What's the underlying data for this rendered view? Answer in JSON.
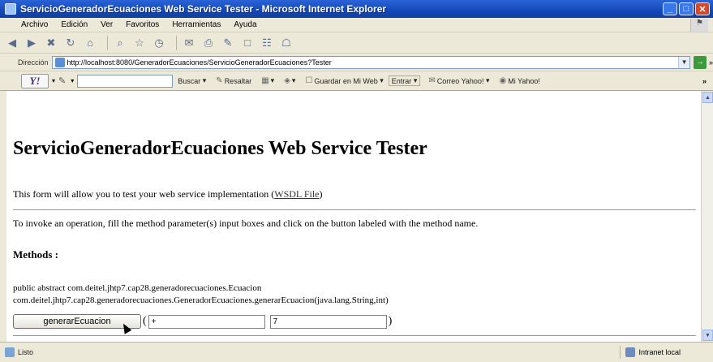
{
  "window": {
    "title": "ServicioGeneradorEcuaciones Web Service Tester - Microsoft Internet Explorer",
    "minimize": "_",
    "maximize": "□",
    "close": "✕"
  },
  "menubar": {
    "items": [
      "Archivo",
      "Edición",
      "Ver",
      "Favoritos",
      "Herramientas",
      "Ayuda"
    ]
  },
  "address": {
    "label": "Dirección",
    "url": "http://localhost:8080/GeneradorEcuaciones/ServicioGeneradorEcuaciones?Tester",
    "go_more": "»"
  },
  "yahoo": {
    "logo": "Y!",
    "search_label": "Buscar",
    "highlight_label": "Resaltar",
    "save_label": "Guardar en Mi Web",
    "enter_label": "Entrar",
    "mail_label": "Correo Yahoo!",
    "myyahoo_label": "Mi Yahoo!",
    "more": "»"
  },
  "page": {
    "title": "ServicioGeneradorEcuaciones Web Service Tester",
    "intro_text": "This form will allow you to test your web service implementation (",
    "intro_link": "WSDL File",
    "intro_close": ")",
    "invoke_text": "To invoke an operation, fill the method parameter(s) input boxes and click on the button labeled with the method name.",
    "methods_heading": "Methods :",
    "signature_line1": "public abstract com.deitel.jhtp7.cap28.generadorecuaciones.Ecuacion",
    "signature_line2": "com.deitel.jhtp7.cap28.generadorecuaciones.GeneradorEcuaciones.generarEcuacion(java.lang.String,int)",
    "operation_button": "generarEcuacion",
    "param_open": "(",
    "param_close": ")",
    "param1_value": "+",
    "param2_value": "7"
  },
  "status": {
    "text": "Listo",
    "zone": "Intranet local"
  }
}
